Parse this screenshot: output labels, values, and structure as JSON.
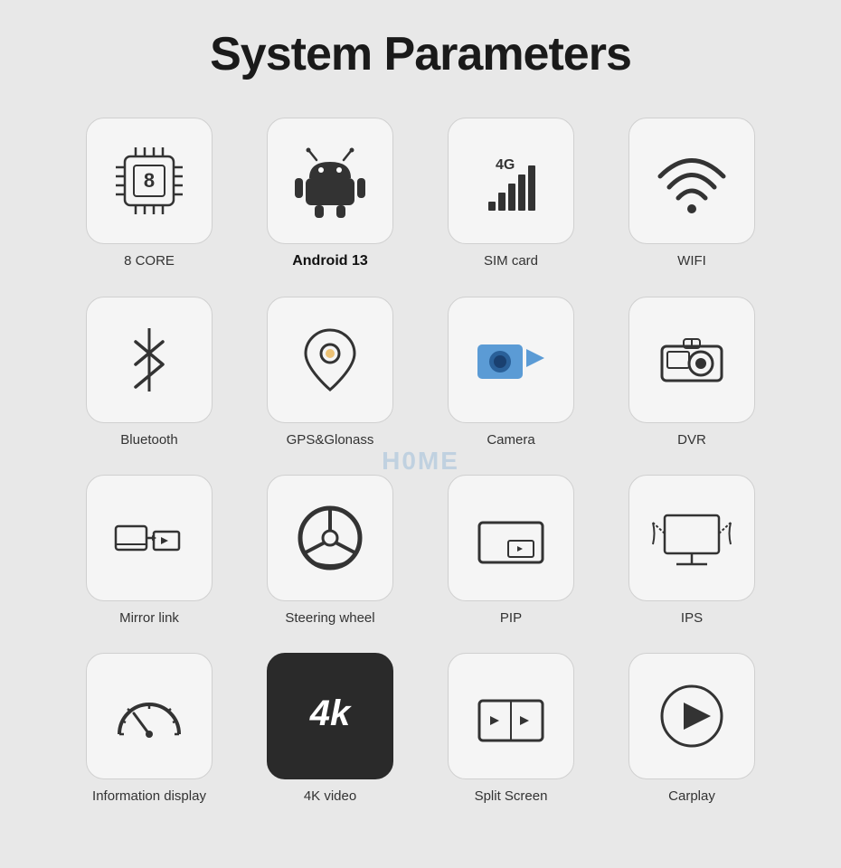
{
  "title": "System Parameters",
  "watermark": "H0ME",
  "features": [
    {
      "id": "8core",
      "label": "8 CORE",
      "labelBold": false
    },
    {
      "id": "android",
      "label": "Android 13",
      "labelBold": true
    },
    {
      "id": "simcard",
      "label": "SIM card",
      "labelBold": false
    },
    {
      "id": "wifi",
      "label": "WIFI",
      "labelBold": false
    },
    {
      "id": "bluetooth",
      "label": "Bluetooth",
      "labelBold": false
    },
    {
      "id": "gps",
      "label": "GPS&Glonass",
      "labelBold": false
    },
    {
      "id": "camera",
      "label": "Camera",
      "labelBold": false
    },
    {
      "id": "dvr",
      "label": "DVR",
      "labelBold": false
    },
    {
      "id": "mirrorlink",
      "label": "Mirror link",
      "labelBold": false
    },
    {
      "id": "steering",
      "label": "Steering wheel",
      "labelBold": false
    },
    {
      "id": "pip",
      "label": "PIP",
      "labelBold": false
    },
    {
      "id": "ips",
      "label": "IPS",
      "labelBold": false
    },
    {
      "id": "infodisplay",
      "label": "Information display",
      "labelBold": false
    },
    {
      "id": "4kvideo",
      "label": "4K video",
      "labelBold": false
    },
    {
      "id": "splitscreen",
      "label": "Split Screen",
      "labelBold": false
    },
    {
      "id": "carplay",
      "label": "Carplay",
      "labelBold": false
    }
  ]
}
